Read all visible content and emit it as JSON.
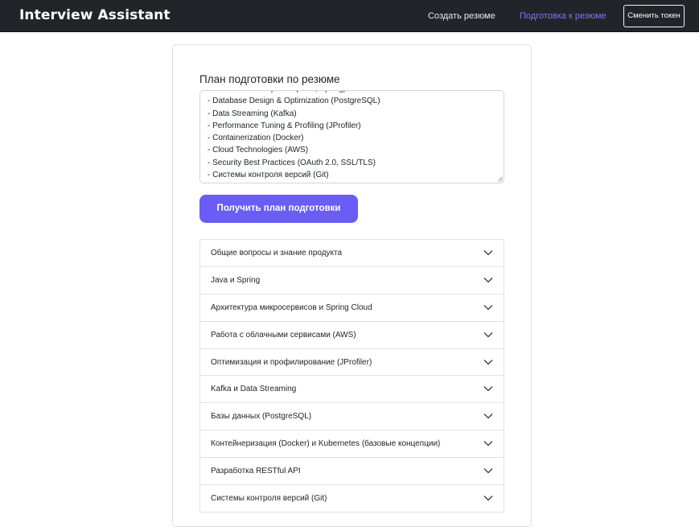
{
  "header": {
    "brand": "Interview Assistant",
    "nav": [
      "Создать резюме",
      "Подготовка к резюме"
    ],
    "active_color": "#8176f7",
    "change_token": "Сменить токен"
  },
  "main": {
    "section_title": "План подготовки по резюме",
    "plan_lines": [
      "- Database Design & Optimization (PostgreSQL)",
      "- Data Streaming (Kafka)",
      "- Performance Tuning & Profiling (JProfiler)",
      "- Containerization (Docker)",
      "- Cloud Technologies (AWS)",
      "- Security Best Practices (OAuth 2.0, SSL/TLS)",
      "-  Системы контроля версий (Git)"
    ],
    "submit_label": "Получить план подготовки",
    "accent_color": "#6a5cf6",
    "topics": [
      "Общие вопросы и знание продукта",
      "Java и Spring",
      "Архитектура микросервисов и Spring Cloud",
      "Работа с облачными сервисами (AWS)",
      "Оптимизация и профилирование (JProfiler)",
      "Kafka и Data Streaming",
      "Базы данных (PostgreSQL)",
      "Контейнеризация (Docker) и Kubernetes (базовые концепции)",
      "Разработка RESTful API",
      "Системы контроля версий (Git)"
    ],
    "topic_icon": "chevron-down-icon"
  }
}
